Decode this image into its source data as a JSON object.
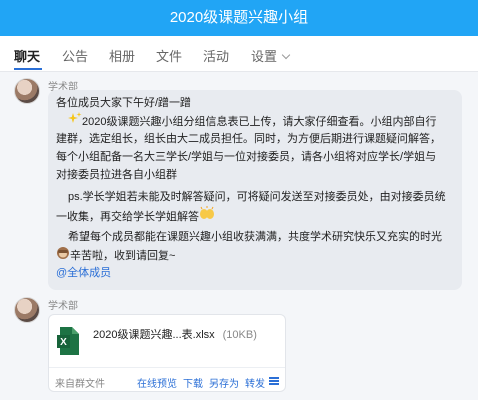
{
  "window": {
    "title": "2020级课题兴趣小组"
  },
  "tabs": [
    {
      "label": "聊天"
    },
    {
      "label": "公告"
    },
    {
      "label": "相册"
    },
    {
      "label": "文件"
    },
    {
      "label": "活动"
    },
    {
      "label": "设置"
    }
  ],
  "messages": [
    {
      "sender": "学术部",
      "lines": [
        "各位成员大家下午好/蹭一蹭",
        "2020级课题兴趣小组分组信息表已上传，请大家仔细查看。小组内部自行",
        "建群，选定组长，组长由大二成员担任。同时，为方便后期进行课题疑问解答，",
        "每个小组配备一名大三学长/学姐与一位对接委员，请各小组将对应学长/学姐与",
        "对接委员拉进各自小组群",
        "ps.学长学姐若未能及时解答疑问，可将疑问发送至对接委员处，由对接委员统",
        "一收集，再交给学长学姐解答",
        "希望每个成员都能在课题兴趣小组收获满满，共度学术研究快乐又充实的时光",
        "辛苦啦，收到请回复~"
      ],
      "mention": "@全体成员"
    },
    {
      "sender": "学术部",
      "file": {
        "name": "2020级课题兴趣...表.xlsx",
        "size": "(10KB)",
        "source": "来自群文件",
        "actions": [
          "在线预览",
          "下载",
          "另存为",
          "转发"
        ]
      }
    }
  ],
  "colors": {
    "accent": "#21a5f5",
    "link": "#2b6fd6",
    "excel": "#1d7344"
  },
  "icons": {
    "sparkle": "sparkles-icon",
    "hands": "raised-hands-icon",
    "monkey": "see-no-evil-monkey-icon",
    "excel": "excel-file-icon",
    "more": "menu-icon"
  }
}
